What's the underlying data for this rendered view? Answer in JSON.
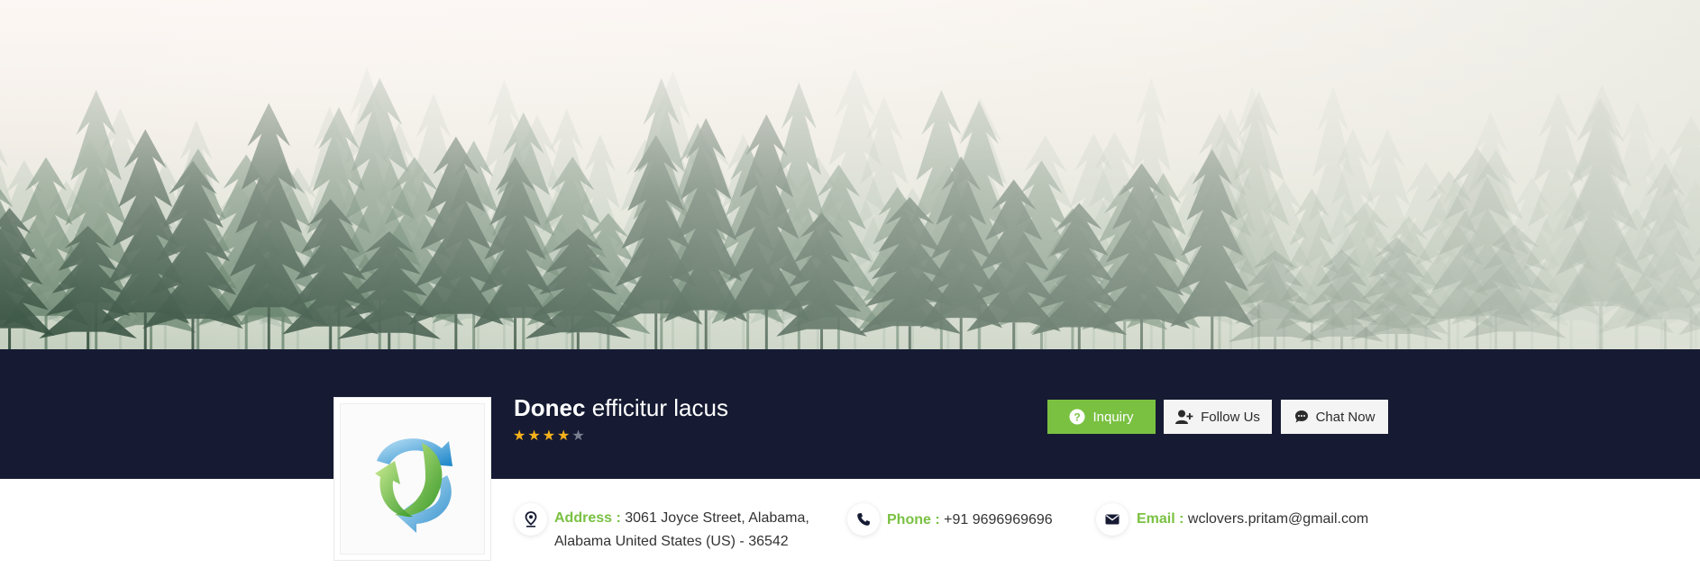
{
  "company": {
    "name_bold": "Donec",
    "name_rest": " efficitur lacus",
    "rating": 4,
    "rating_max": 5
  },
  "buttons": {
    "inquiry": "Inquiry",
    "follow": "Follow Us",
    "chat": "Chat Now"
  },
  "contact": {
    "address_label": "Address :",
    "address_line1": "3061 Joyce Street, Alabama,",
    "address_line2": "Alabama United States (US) - 36542",
    "phone_label": "Phone :",
    "phone_value": "+91 9696969696",
    "email_label": "Email :",
    "email_value": "wclovers.pritam@gmail.com"
  },
  "colors": {
    "accent_green": "#7ac142",
    "dark_strip": "#161b33",
    "star_gold": "#f6b21b",
    "star_empty": "#7a7f90"
  },
  "icons": {
    "inquiry": "question-circle-icon",
    "follow": "user-plus-icon",
    "chat": "chat-bubble-icon",
    "address": "map-pin-icon",
    "phone": "phone-icon",
    "email": "envelope-icon"
  }
}
